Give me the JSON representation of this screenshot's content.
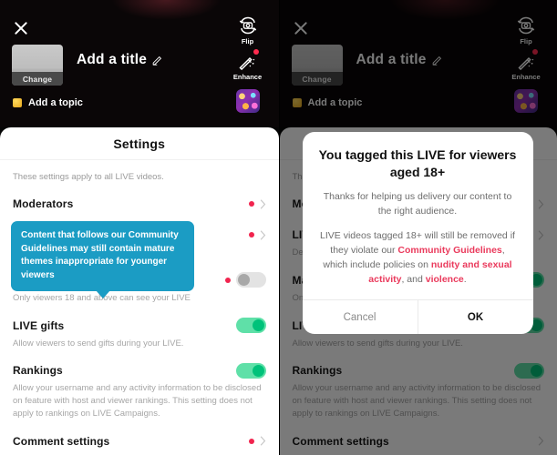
{
  "capture": {
    "close_icon": "close-icon",
    "thumbnail_change_label": "Change",
    "title_placeholder": "Add a title",
    "edit_icon": "pencil-icon",
    "topic_label": "Add a topic",
    "rail": [
      {
        "label": "Flip",
        "icon": "camera-flip-icon",
        "badge": false
      },
      {
        "label": "Enhance",
        "icon": "magic-wand-icon",
        "badge": true
      }
    ],
    "effects_icon": "effects-thumbnail"
  },
  "sheet": {
    "title": "Settings",
    "intro": "These settings apply to all LIVE videos.",
    "rows": [
      {
        "name": "Moderators",
        "type": "link",
        "badge": true,
        "desc": ""
      },
      {
        "name": "LIVE Q&A",
        "type": "link",
        "badge": true,
        "desc": "Description"
      },
      {
        "name": "Mature themes",
        "type": "toggle",
        "toggle": "off",
        "badge": true,
        "info": true,
        "desc": "Only viewers 18 and above can see your LIVE"
      },
      {
        "name": "LIVE gifts",
        "type": "toggle",
        "toggle": "on",
        "badge": false,
        "desc": "Allow viewers to send gifts during your LIVE."
      },
      {
        "name": "Rankings",
        "type": "toggle",
        "toggle": "on",
        "badge": false,
        "desc": "Allow your username and any activity information to be disclosed on feature with host and viewer rankings. This setting does not apply to rankings on LIVE Campaigns."
      },
      {
        "name": "Comment settings",
        "type": "link",
        "badge": true,
        "desc": ""
      }
    ]
  },
  "tooltip": {
    "text": "Content that follows our Community Guidelines may still contain mature themes inappropriate for younger viewers"
  },
  "modal": {
    "title": "You tagged this LIVE for viewers aged 18+",
    "paragraph_1": "Thanks for helping us delivery our content to the right audience.",
    "paragraph_2_parts": [
      {
        "text": "LIVE videos tagged 18+ will still be removed if they violate our ",
        "link": false
      },
      {
        "text": "Community Guidelines",
        "link": true
      },
      {
        "text": ", which include policies on ",
        "link": false
      },
      {
        "text": "nudity and sexual activity",
        "link": true
      },
      {
        "text": ", and ",
        "link": false
      },
      {
        "text": "violence",
        "link": true
      },
      {
        "text": ".",
        "link": false
      }
    ],
    "cancel_label": "Cancel",
    "ok_label": "OK"
  },
  "colors": {
    "tooltip_bg": "#1b9cc4",
    "toggle_on": "#00c27a",
    "badge_red": "#f1244e",
    "link_red": "#ea3a5c"
  }
}
